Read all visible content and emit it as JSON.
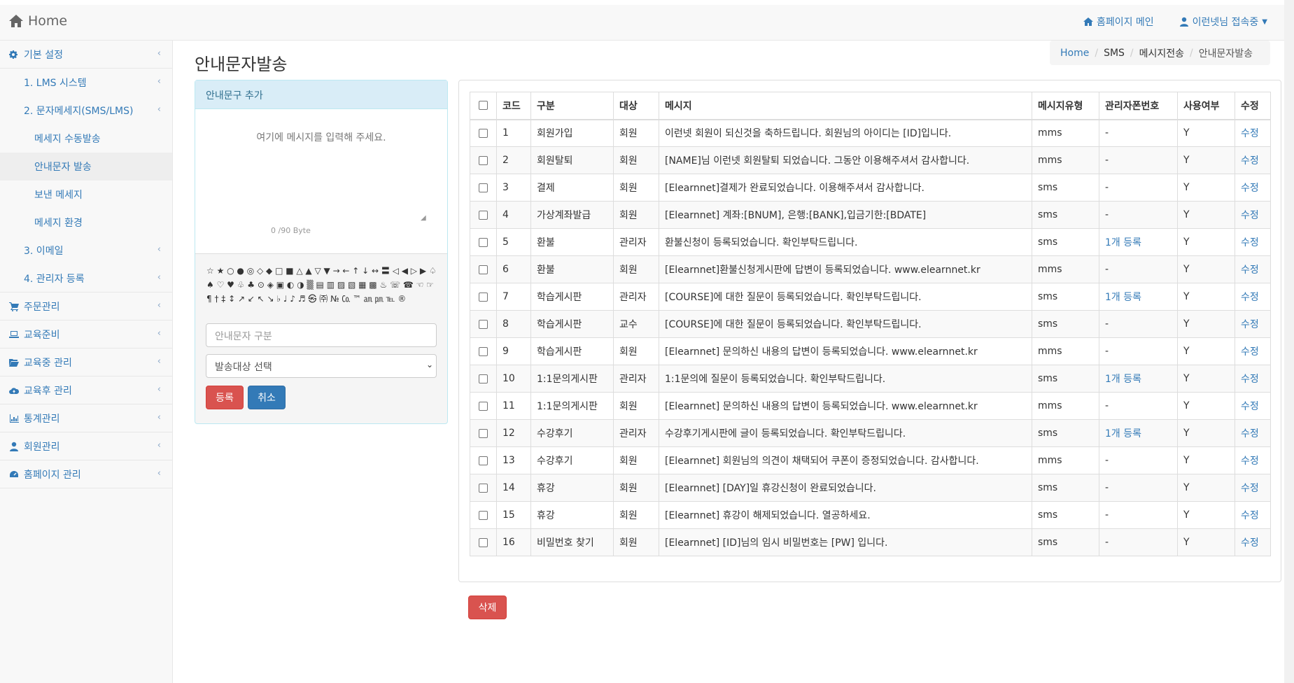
{
  "header": {
    "brand": "Home",
    "homepage_main": "홈페이지 메인",
    "user_status": "이런넷님 접속중"
  },
  "sidebar": {
    "items": [
      {
        "label": "기본 설정",
        "level": 1,
        "icon": "gears-icon"
      },
      {
        "label": "1. LMS 시스템",
        "level": 2
      },
      {
        "label": "2. 문자메세지(SMS/LMS)",
        "level": 2
      },
      {
        "label": "메세지 수동발송",
        "level": 3
      },
      {
        "label": "안내문자 발송",
        "level": 3,
        "active": true
      },
      {
        "label": "보낸 메세지",
        "level": 3
      },
      {
        "label": "메세지 환경",
        "level": 3
      },
      {
        "label": "3. 이메일",
        "level": 2
      },
      {
        "label": "4. 관리자 등록",
        "level": 2
      },
      {
        "label": "주문관리",
        "level": 1,
        "icon": "cart-icon"
      },
      {
        "label": "교육준비",
        "level": 1,
        "icon": "laptop-icon"
      },
      {
        "label": "교육중 관리",
        "level": 1,
        "icon": "folder-open-icon"
      },
      {
        "label": "교육후 관리",
        "level": 1,
        "icon": "cloud-upload-icon"
      },
      {
        "label": "통계관리",
        "level": 1,
        "icon": "bar-chart-icon"
      },
      {
        "label": "회원관리",
        "level": 1,
        "icon": "user-icon"
      },
      {
        "label": "홈페이지 관리",
        "level": 1,
        "icon": "dashboard-icon"
      }
    ]
  },
  "page": {
    "title": "안내문자발송",
    "breadcrumb": [
      "Home",
      "SMS",
      "메시지전송",
      "안내문자발송"
    ]
  },
  "form": {
    "panel_title": "안내문구 추가",
    "message_placeholder": "여기에 메시지를 입력해 주세요.",
    "byte_counter": "0  /90 Byte",
    "symbols": "☆ ★ ○ ● ◎ ◇ ◆ □ ■ △ ▲ ▽ ▼ → ← ↑ ↓ ↔ 〓 ◁ ◀ ▷ ▶ ♤ ♠ ♡ ♥ ♧ ♣ ⊙ ◈ ▣ ◐ ◑ ▒ ▤ ▥ ▨ ▧ ▦ ▩ ♨ ☏ ☎ ☜ ☞ ¶ † ‡ ↕ ↗ ↙ ↖ ↘ ♭ ♩ ♪ ♬ ㉿ ㈜ № ㏇ ™ ㏂ ㏘ ℡ ®",
    "category_placeholder": "안내문자 구분",
    "target_select": "발송대상 선택",
    "register_label": "등록",
    "cancel_label": "취소"
  },
  "table": {
    "headers": [
      "코드",
      "구분",
      "대상",
      "메시지",
      "메시지유형",
      "관리자폰번호",
      "사용여부",
      "수정"
    ],
    "rows": [
      {
        "code": "1",
        "category": "회원가입",
        "target": "회원",
        "message": "이런넷 회원이 되신것을 축하드립니다. 회원님의 아이디는 [ID]입니다.",
        "type": "mms",
        "phone": "-",
        "use": "Y",
        "edit": "수정"
      },
      {
        "code": "2",
        "category": "회원탈퇴",
        "target": "회원",
        "message": "[NAME]님 이런넷 회원탈퇴 되었습니다. 그동안 이용해주셔서 감사합니다.",
        "type": "mms",
        "phone": "-",
        "use": "Y",
        "edit": "수정"
      },
      {
        "code": "3",
        "category": "결제",
        "target": "회원",
        "message": "[Elearnnet]결제가 완료되었습니다. 이용해주셔서 감사합니다.",
        "type": "sms",
        "phone": "-",
        "use": "Y",
        "edit": "수정"
      },
      {
        "code": "4",
        "category": "가상계좌발급",
        "target": "회원",
        "message": "[Elearnnet] 계좌:[BNUM], 은행:[BANK],입금기한:[BDATE]",
        "type": "sms",
        "phone": "-",
        "use": "Y",
        "edit": "수정"
      },
      {
        "code": "5",
        "category": "환불",
        "target": "관리자",
        "message": "환불신청이 등록되었습니다. 확인부탁드립니다.",
        "type": "sms",
        "phone": "1개 등록",
        "use": "Y",
        "edit": "수정"
      },
      {
        "code": "6",
        "category": "환불",
        "target": "회원",
        "message": "[Elearnnet]환불신청게시판에 답변이 등록되었습니다. www.elearnnet.kr",
        "type": "mms",
        "phone": "-",
        "use": "Y",
        "edit": "수정"
      },
      {
        "code": "7",
        "category": "학습게시판",
        "target": "관리자",
        "message": "[COURSE]에 대한 질문이 등록되었습니다. 확인부탁드립니다.",
        "type": "sms",
        "phone": "1개 등록",
        "use": "Y",
        "edit": "수정"
      },
      {
        "code": "8",
        "category": "학습게시판",
        "target": "교수",
        "message": "[COURSE]에 대한 질문이 등록되었습니다. 확인부탁드립니다.",
        "type": "sms",
        "phone": "-",
        "use": "Y",
        "edit": "수정"
      },
      {
        "code": "9",
        "category": "학습게시판",
        "target": "회원",
        "message": "[Elearnnet] 문의하신 내용의 답변이 등록되었습니다. www.elearnnet.kr",
        "type": "mms",
        "phone": "-",
        "use": "Y",
        "edit": "수정"
      },
      {
        "code": "10",
        "category": "1:1문의게시판",
        "target": "관리자",
        "message": "1:1문의에 질문이 등록되었습니다. 확인부탁드립니다.",
        "type": "sms",
        "phone": "1개 등록",
        "use": "Y",
        "edit": "수정"
      },
      {
        "code": "11",
        "category": "1:1문의게시판",
        "target": "회원",
        "message": "[Elearnnet] 문의하신 내용의 답변이 등록되었습니다. www.elearnnet.kr",
        "type": "mms",
        "phone": "-",
        "use": "Y",
        "edit": "수정"
      },
      {
        "code": "12",
        "category": "수강후기",
        "target": "관리자",
        "message": "수강후기게시판에 글이 등록되었습니다. 확인부탁드립니다.",
        "type": "sms",
        "phone": "1개 등록",
        "use": "Y",
        "edit": "수정"
      },
      {
        "code": "13",
        "category": "수강후기",
        "target": "회원",
        "message": "[Elearnnet] 회원님의 의견이 채택되어 쿠폰이 증정되었습니다. 감사합니다.",
        "type": "mms",
        "phone": "-",
        "use": "Y",
        "edit": "수정"
      },
      {
        "code": "14",
        "category": "휴강",
        "target": "회원",
        "message": "[Elearnnet] [DAY]일 휴강신청이 완료되었습니다.",
        "type": "sms",
        "phone": "-",
        "use": "Y",
        "edit": "수정"
      },
      {
        "code": "15",
        "category": "휴강",
        "target": "회원",
        "message": "[Elearnnet] 휴강이 해제되었습니다. 열공하세요.",
        "type": "sms",
        "phone": "-",
        "use": "Y",
        "edit": "수정"
      },
      {
        "code": "16",
        "category": "비밀번호 찾기",
        "target": "회원",
        "message": "[Elearnnet] [ID]님의 임시 비밀번호는 [PW] 입니다.",
        "type": "sms",
        "phone": "-",
        "use": "Y",
        "edit": "수정"
      }
    ]
  },
  "delete_label": "삭제",
  "colors": {
    "link": "#337ab7",
    "danger": "#d9534f",
    "info_bg": "#d9edf7"
  }
}
